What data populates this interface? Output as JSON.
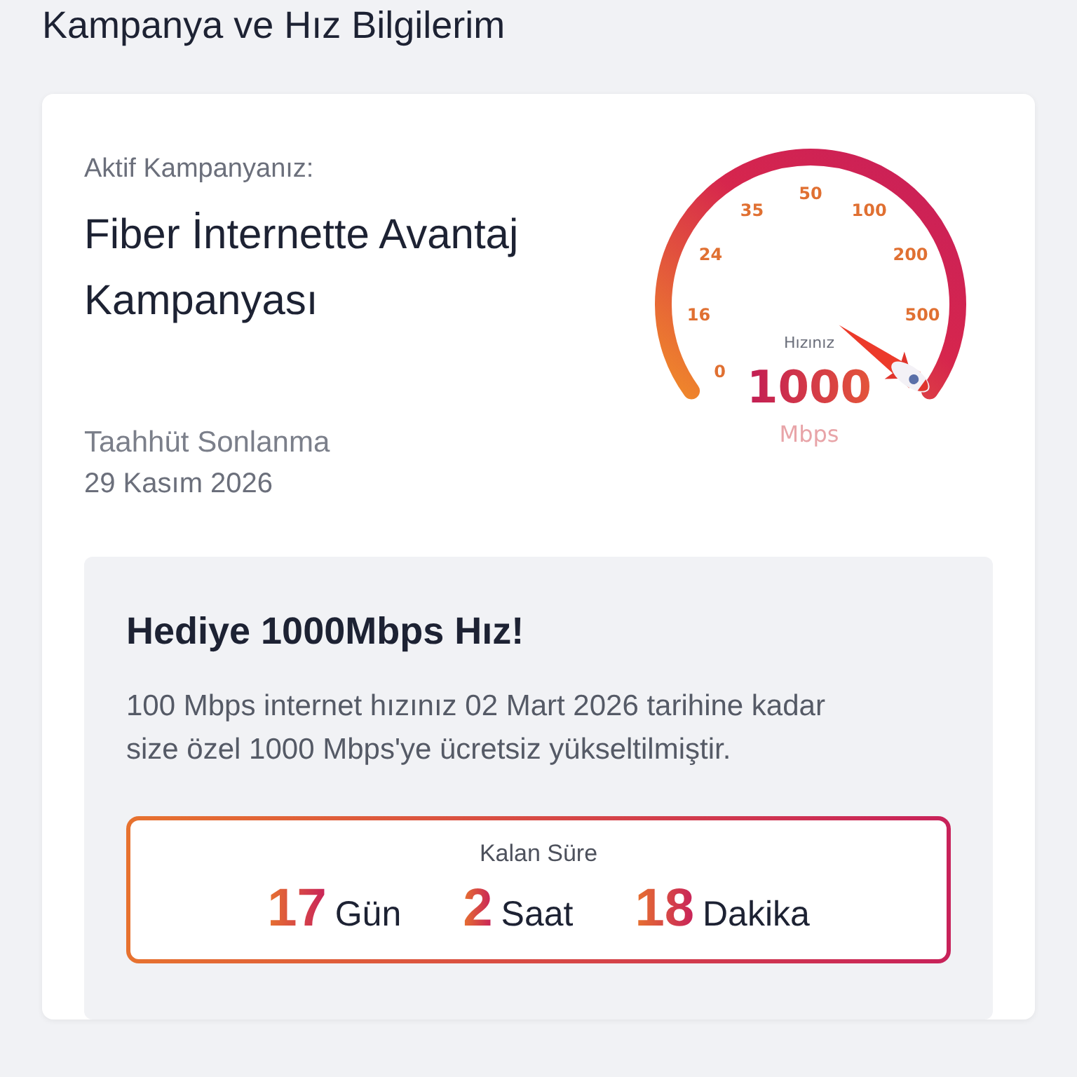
{
  "page_title": "Kampanya ve Hız Bilgilerim",
  "campaign": {
    "label": "Aktif Kampanyanız:",
    "name": "Fiber İnternette Avantaj Kampanyası",
    "commitment_label": "Taahhüt Sonlanma",
    "commitment_date": "29 Kasım 2026"
  },
  "gauge": {
    "ticks": [
      "0",
      "16",
      "24",
      "35",
      "50",
      "100",
      "200",
      "500"
    ],
    "caption": "Hızınız",
    "speed": "1000",
    "unit": "Mbps"
  },
  "gift": {
    "title": "Hediye 1000Mbps Hız!",
    "text": "100 Mbps internet hızınız 02 Mart 2026 tarihine kadar size özel 1000 Mbps'ye ücretsiz yükseltilmiştir.",
    "countdown": {
      "label": "Kalan Süre",
      "parts": [
        {
          "value": "17",
          "unit": "Gün"
        },
        {
          "value": "2",
          "unit": "Saat"
        },
        {
          "value": "18",
          "unit": "Dakika"
        }
      ]
    }
  }
}
